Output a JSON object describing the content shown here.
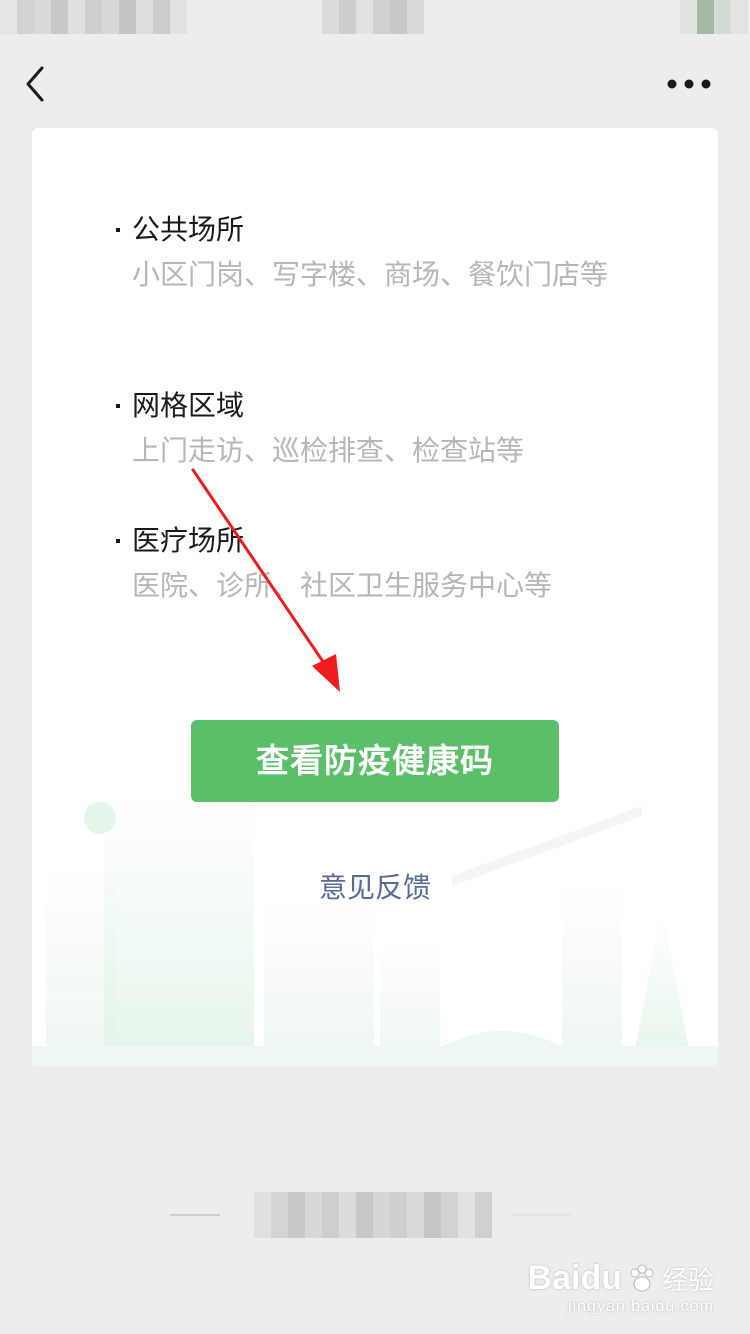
{
  "nav": {
    "back_icon": "chevron-left-icon",
    "more_icon": "more-dots-icon"
  },
  "sections": [
    {
      "title": "公共场所",
      "desc": "小区门岗、写字楼、商场、餐饮门店等"
    },
    {
      "title": "网格区域",
      "desc": "上门走访、巡检排查、检查站等"
    },
    {
      "title": "医疗场所",
      "desc": "医院、诊所、社区卫生服务中心等"
    }
  ],
  "main_button": {
    "label": "查看防疫健康码"
  },
  "feedback": {
    "label": "意见反馈"
  },
  "watermark": {
    "brand": "Baidu",
    "product": "经验",
    "url": "jingyan.baidu.com"
  },
  "colors": {
    "primary_green": "#5bbf6a",
    "link_blue": "#576b95",
    "annotation_arrow": "#ee1c1c",
    "background": "#ededed"
  }
}
